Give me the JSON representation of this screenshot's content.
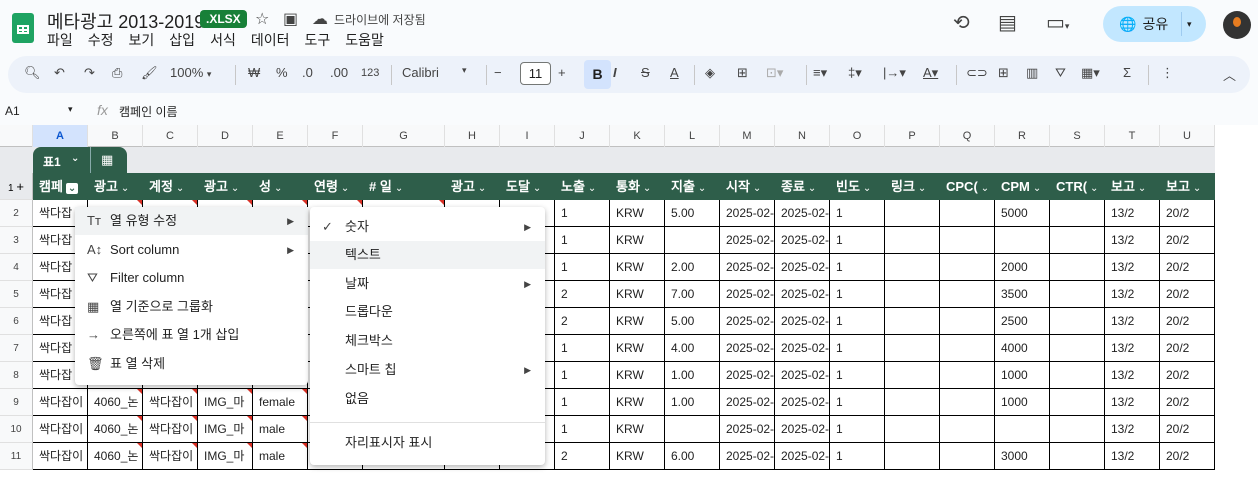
{
  "doc": {
    "title": "메타광고 2013-2019",
    "badge": ".XLSX",
    "saved": "드라이브에 저장됨"
  },
  "menubar": [
    "파일",
    "수정",
    "보기",
    "삽입",
    "서식",
    "데이터",
    "도구",
    "도움말"
  ],
  "share": {
    "label": "공유"
  },
  "toolbar": {
    "zoom": "100%",
    "currency": "₩",
    "percent": "%",
    "dec_dec": ".0",
    "inc_dec": ".00",
    "format": "123",
    "font": "Calibri",
    "font_size": "11",
    "bold": "B",
    "italic": "I"
  },
  "formula_bar": {
    "cell": "A1",
    "fx": "fx",
    "value": "캠페인 이름"
  },
  "columns": [
    "A",
    "B",
    "C",
    "D",
    "E",
    "F",
    "G",
    "H",
    "I",
    "J",
    "K",
    "L",
    "M",
    "N",
    "O",
    "P",
    "Q",
    "R",
    "S",
    "T",
    "U"
  ],
  "table": {
    "name": "표1",
    "headers": [
      "캠페",
      "광고",
      "계정",
      "광고",
      "성",
      "연령",
      "# 일",
      "광고",
      "도달",
      "노출",
      "통화",
      "지출",
      "시작",
      "종료",
      "빈도",
      "링크",
      "CPC(",
      "CPM",
      "CTR(",
      "보고",
      "보고"
    ]
  },
  "rows": [
    {
      "n": "2",
      "a": "싹다잡",
      "b": "",
      "c": "",
      "d": "",
      "e": "",
      "v": [
        "1",
        "KRW",
        "5.00",
        "2025-02-",
        "2025-02-",
        "1",
        "",
        "",
        "5000",
        "",
        "13/2",
        "20/2"
      ]
    },
    {
      "n": "3",
      "a": "싹다잡",
      "b": "",
      "c": "",
      "d": "",
      "e": "",
      "v": [
        "1",
        "KRW",
        "",
        "2025-02-",
        "2025-02-",
        "1",
        "",
        "",
        "",
        "",
        "13/2",
        "20/2"
      ]
    },
    {
      "n": "4",
      "a": "싹다잡",
      "b": "",
      "c": "",
      "d": "",
      "e": "",
      "v": [
        "1",
        "KRW",
        "2.00",
        "2025-02-",
        "2025-02-",
        "1",
        "",
        "",
        "2000",
        "",
        "13/2",
        "20/2"
      ]
    },
    {
      "n": "5",
      "a": "싹다잡",
      "b": "",
      "c": "",
      "d": "",
      "e": "",
      "v": [
        "2",
        "KRW",
        "7.00",
        "2025-02-",
        "2025-02-",
        "1",
        "",
        "",
        "3500",
        "",
        "13/2",
        "20/2"
      ]
    },
    {
      "n": "6",
      "a": "싹다잡",
      "b": "",
      "c": "",
      "d": "",
      "e": "",
      "v": [
        "2",
        "KRW",
        "5.00",
        "2025-02-",
        "2025-02-",
        "1",
        "",
        "",
        "2500",
        "",
        "13/2",
        "20/2"
      ]
    },
    {
      "n": "7",
      "a": "싹다잡",
      "b": "",
      "c": "",
      "d": "",
      "e": "",
      "v": [
        "1",
        "KRW",
        "4.00",
        "2025-02-",
        "2025-02-",
        "1",
        "",
        "",
        "4000",
        "",
        "13/2",
        "20/2"
      ]
    },
    {
      "n": "8",
      "a": "싹다잡",
      "b": "",
      "c": "",
      "d": "",
      "e": "",
      "v": [
        "1",
        "KRW",
        "1.00",
        "2025-02-",
        "2025-02-",
        "1",
        "",
        "",
        "1000",
        "",
        "13/2",
        "20/2"
      ]
    },
    {
      "n": "9",
      "a": "싹다잡이",
      "b": "4060_논",
      "c": "싹다잡이",
      "d": "IMG_마",
      "e": "female",
      "v": [
        "1",
        "KRW",
        "1.00",
        "2025-02-",
        "2025-02-",
        "1",
        "",
        "",
        "1000",
        "",
        "13/2",
        "20/2"
      ]
    },
    {
      "n": "10",
      "a": "싹다잡이",
      "b": "4060_논",
      "c": "싹다잡이",
      "d": "IMG_마",
      "e": "male",
      "v": [
        "1",
        "KRW",
        "",
        "2025-02-",
        "2025-02-",
        "1",
        "",
        "",
        "",
        "",
        "13/2",
        "20/2"
      ]
    },
    {
      "n": "11",
      "a": "싹다잡이",
      "b": "4060_논",
      "c": "싹다잡이",
      "d": "IMG_마",
      "e": "male",
      "v": [
        "2",
        "KRW",
        "6.00",
        "2025-02-",
        "2025-02-",
        "1",
        "",
        "",
        "3000",
        "",
        "13/2",
        "20/2"
      ]
    }
  ],
  "context_menu": [
    "열 유형 수정",
    "Sort column",
    "Filter column",
    "열 기준으로 그룹화",
    "오른쪽에 표 열 1개 삽입",
    "표 열 삭제"
  ],
  "submenu": [
    "숫자",
    "텍스트",
    "날짜",
    "드롭다운",
    "체크박스",
    "스마트 칩",
    "없음",
    "자리표시자 표시"
  ],
  "colors": {
    "table_header": "#2e5e4a",
    "share_bg": "#c2e7ff",
    "badge": "#188038"
  }
}
